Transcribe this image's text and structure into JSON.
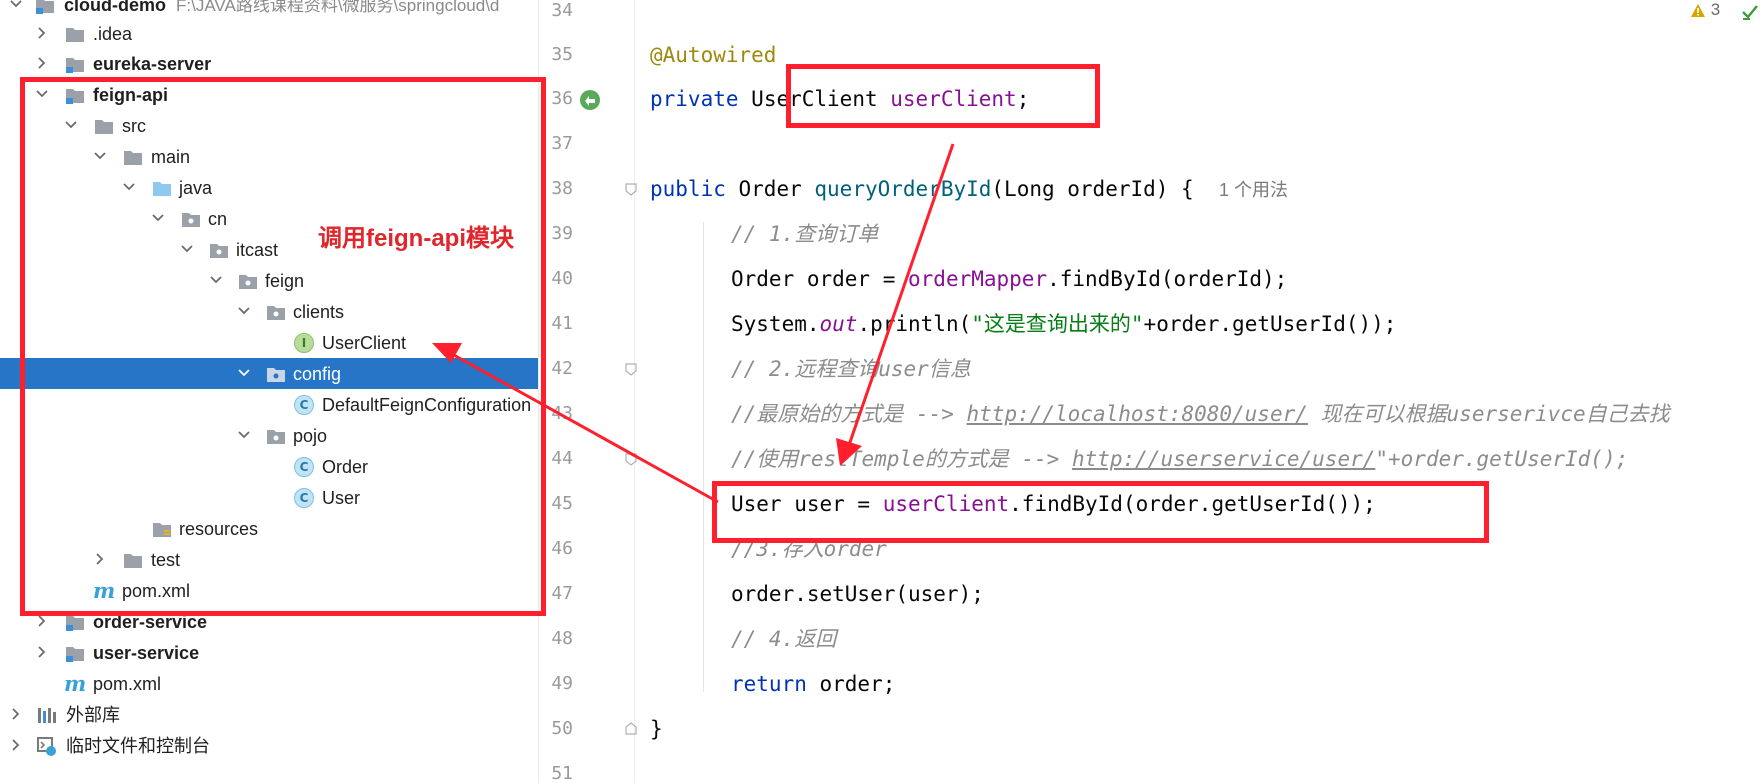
{
  "tree": {
    "rows": [
      {
        "label": "cloud-demo",
        "bold": true,
        "path": "F:\\JAVA路线课程资料\\微服务\\springcloud\\d"
      },
      {
        "label": ".idea"
      },
      {
        "label": "eureka-server",
        "bold": true
      },
      {
        "label": "feign-api",
        "bold": true
      },
      {
        "label": "src"
      },
      {
        "label": "main"
      },
      {
        "label": "java"
      },
      {
        "label": "cn"
      },
      {
        "label": "itcast"
      },
      {
        "label": "feign"
      },
      {
        "label": "clients"
      },
      {
        "label": "UserClient",
        "badge": "I"
      },
      {
        "label": "config"
      },
      {
        "label": "DefaultFeignConfiguration",
        "badge": "C"
      },
      {
        "label": "pojo"
      },
      {
        "label": "Order",
        "badge": "C"
      },
      {
        "label": "User",
        "badge": "C"
      },
      {
        "label": "resources"
      },
      {
        "label": "test"
      },
      {
        "label": "pom.xml",
        "badge": "m"
      },
      {
        "label": "order-service",
        "bold": true
      },
      {
        "label": "user-service",
        "bold": true
      },
      {
        "label": "pom.xml",
        "badge": "m"
      },
      {
        "label": "外部库"
      },
      {
        "label": "临时文件和控制台"
      }
    ],
    "selected_label": "config"
  },
  "editor": {
    "line_numbers": [
      "34",
      "35",
      "36",
      "37",
      "38",
      "39",
      "40",
      "41",
      "42",
      "43",
      "44",
      "45",
      "46",
      "47",
      "48",
      "49",
      "50",
      "51"
    ],
    "usage_hint": "1 个用法",
    "tokens": {
      "ann_autowired": "@Autowired",
      "kw_private": "private",
      "type_userclient": "UserClient",
      "fld_userclient": "userClient",
      "semi": ";",
      "kw_public": "public",
      "type_order": "Order",
      "fn_query": "queryOrderById",
      "params": "(Long orderId) {",
      "c1": "// 1.查询订单",
      "l40_a": "Order order = ",
      "l40_fld": "orderMapper",
      "l40_b": ".findById(orderId);",
      "l41_a": "System.",
      "l41_out": "out",
      "l41_b": ".println(",
      "l41_str": "\"这是查询出来的\"",
      "l41_c": "+order.getUserId());",
      "c2": "// 2.远程查询user信息",
      "c3_a": "//最原始的方式是 --> ",
      "c3_url": "http://localhost:8080/user/",
      "c3_b": " 现在可以根据userserivce自己去找",
      "c4_a": "//使用restTemple的方式是 --> ",
      "c4_url": "http://userservice/user/",
      "c4_b": "\"+order.getUserId();",
      "l45_a": "User user = ",
      "l45_fld": "userClient",
      "l45_b": ".findById(order.getUserId());",
      "c5": "//3.存入order",
      "l47": "order.setUser(user);",
      "c6": "// 4.返回",
      "kw_return": "return",
      "l49_b": " order;",
      "brace": "}"
    }
  },
  "inspection": {
    "warning_count": "3"
  },
  "annotation": {
    "note": "调用feign-api模块"
  },
  "colors": {
    "selection": "#2675c7",
    "annotation_red": "#ff1f2d"
  }
}
